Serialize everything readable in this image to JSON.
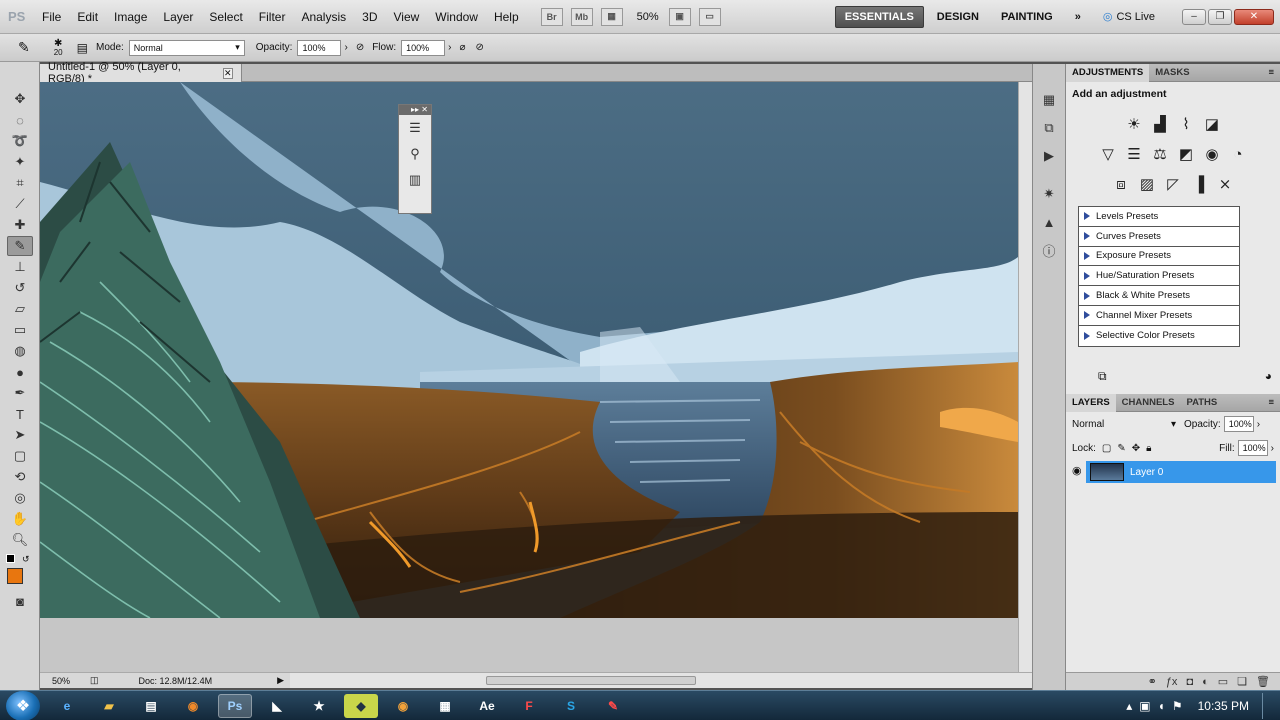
{
  "menubar": {
    "logo": "PS",
    "items": [
      "File",
      "Edit",
      "Image",
      "Layer",
      "Select",
      "Filter",
      "Analysis",
      "3D",
      "View",
      "Window",
      "Help"
    ],
    "bridge_icon": "Br",
    "minibridge_icon": "Mb",
    "zoom": "50%",
    "workspaces": [
      "ESSENTIALS",
      "DESIGN",
      "PAINTING"
    ],
    "cslive": "CS Live"
  },
  "options": {
    "brush_size": "20",
    "mode_label": "Mode:",
    "mode_value": "Normal",
    "opacity_label": "Opacity:",
    "opacity_value": "100%",
    "flow_label": "Flow:",
    "flow_value": "100%"
  },
  "document": {
    "tab_title": "Untitled-1 @ 50% (Layer 0, RGB/8) *",
    "status_zoom": "50%",
    "status_doc": "Doc: 12.8M/12.4M"
  },
  "adjustments": {
    "tab_active": "ADJUSTMENTS",
    "tab_other": "MASKS",
    "title": "Add an adjustment",
    "presets": [
      "Levels Presets",
      "Curves Presets",
      "Exposure Presets",
      "Hue/Saturation Presets",
      "Black & White Presets",
      "Channel Mixer Presets",
      "Selective Color Presets"
    ]
  },
  "layers": {
    "tabs": [
      "LAYERS",
      "CHANNELS",
      "PATHS"
    ],
    "blend_mode": "Normal",
    "opacity_label": "Opacity:",
    "opacity_value": "100%",
    "lock_label": "Lock:",
    "fill_label": "Fill:",
    "fill_value": "100%",
    "layer_name": "Layer 0"
  },
  "taskbar": {
    "clock": "10:35 PM"
  },
  "colors": {
    "foreground": "#000000",
    "background": "#e8760f",
    "selection": "#3797ea"
  }
}
